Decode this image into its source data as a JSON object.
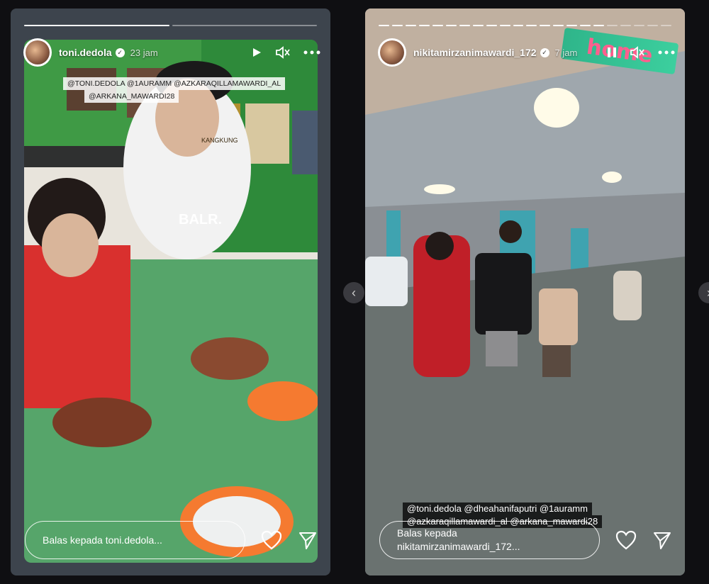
{
  "left_story": {
    "username": "toni.dedola",
    "time": "23 jam",
    "reply_placeholder": "Balas kepada toni.dedola...",
    "mentions": [
      "@TONI.DEDOLA @1AURAMM @AZKARAQILLAMAWARDI_AL",
      "@ARKANA_MAWARDI28"
    ],
    "cap_text": "BALR.",
    "sign_text": "KANGKUNG"
  },
  "right_story": {
    "username": "nikitamirzanimawardi_172",
    "time": "7 jam",
    "reply_line1": "Balas kepada",
    "reply_line2": "nikitamirzanimawardi_172...",
    "mentions": [
      "@toni.dedola @dheahanifaputri @1auramm",
      "@azkaraqillamawardi_al @arkana_mawardi28"
    ],
    "sticker_text": "home"
  },
  "icons": {
    "play": "play-icon",
    "pause": "pause-icon",
    "mute": "muted-speaker-icon",
    "more": "more-options-icon",
    "heart": "heart-icon",
    "send": "send-icon",
    "verified": "verified-badge-icon"
  }
}
